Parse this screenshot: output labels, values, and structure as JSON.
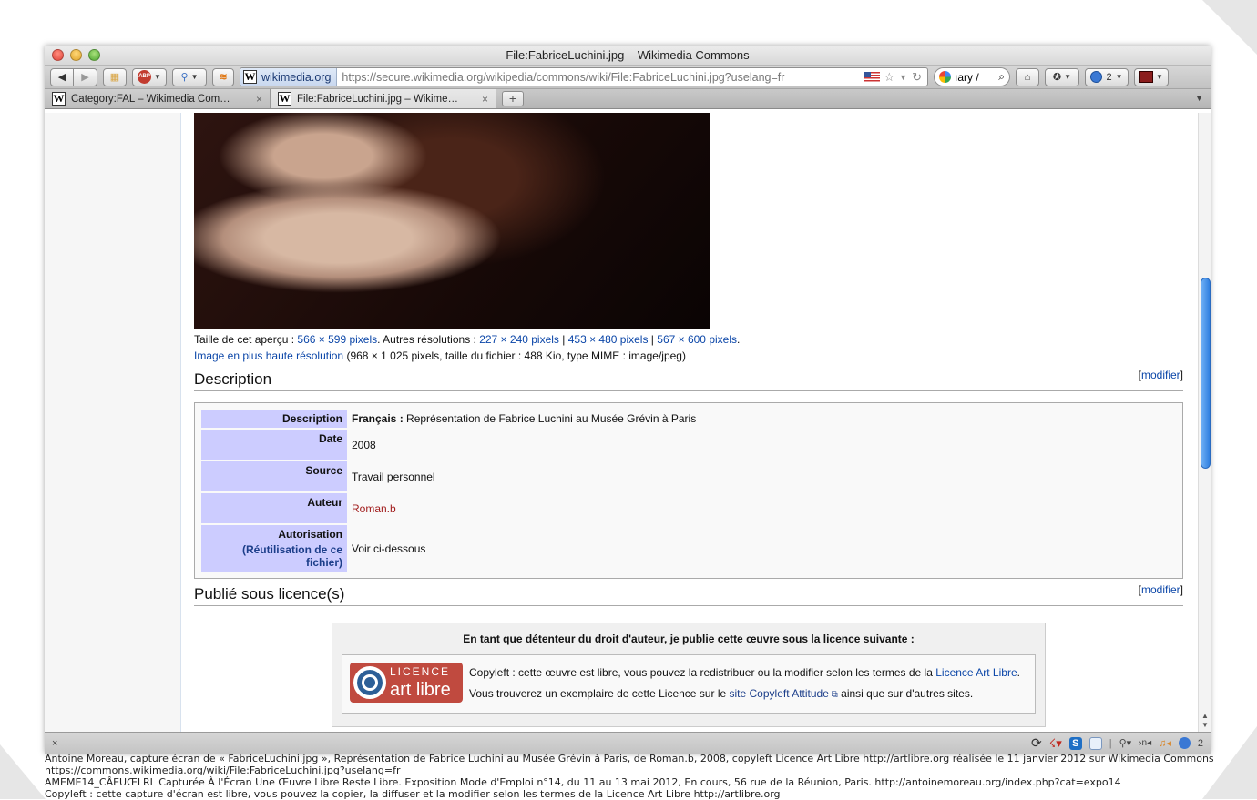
{
  "window": {
    "title": "File:FabriceLuchini.jpg – Wikimedia Commons"
  },
  "navbar": {
    "site_identity": "wikimedia.org",
    "url": "https://secure.wikimedia.org/wikipedia/commons/wiki/File:FabriceLuchini.jpg?uselang=fr",
    "search_text": "ıary /",
    "reader_count": "2",
    "abp_label": "ABP"
  },
  "tabs": [
    {
      "label": "Category:FAL – Wikimedia Com…",
      "close": "×"
    },
    {
      "label": "File:FabriceLuchini.jpg – Wikime…",
      "close": "×"
    }
  ],
  "newtab_label": "+",
  "preview": {
    "size_prefix": "Taille de cet aperçu : ",
    "size_link": "566 × 599 pixels",
    "other_prefix": ". Autres résolutions : ",
    "res1": "227 × 240 pixels",
    "sep": " | ",
    "res2": "453 × 480 pixels",
    "res3": "567 × 600 pixels",
    "end": ".",
    "highres_link": "Image en plus haute résolution",
    "highres_info": " (968 × 1 025 pixels, taille du fichier : 488 Kio, type MIME : image/jpeg)"
  },
  "description_heading": "Description",
  "edit_link": "modifier",
  "info": {
    "description_key": "Description",
    "lang": "Français :",
    "description_value": " Représentation de Fabrice Luchini au Musée Grévin à Paris",
    "date_key": "Date",
    "date_value": "2008",
    "source_key": "Source",
    "source_value": "Travail personnel",
    "author_key": "Auteur",
    "author_value": "Roman.b",
    "permission_key": "Autorisation",
    "permission_link": "(Réutilisation de ce fichier)",
    "permission_value": "Voir ci-dessous"
  },
  "license_heading": "Publié sous licence(s)",
  "license": {
    "header": "En tant que détenteur du droit d'auteur, je publie cette œuvre sous la licence suivante :",
    "logo_line1": "LICENCE",
    "logo_line2": "art libre",
    "text1": "Copyleft : cette œuvre est libre, vous pouvez la redistribuer ou la modifier selon les termes de la ",
    "link1": "Licence Art Libre",
    "text1_end": ".",
    "text2": "Vous trouverez un exemplaire de cette Licence sur le ",
    "link2": "site Copyleft Attitude",
    "text2_end": " ainsi que sur d'autres sites."
  },
  "statusbar": {
    "close": "×",
    "counter": "2"
  },
  "caption": [
    "Antoine Moreau, capture écran de « FabriceLuchini.jpg », Représentation de Fabrice Luchini au Musée Grévin à Paris, de Roman.b, 2008, copyleft Licence Art Libre http://artlibre.org réalisée le 11 janvier 2012 sur Wikimedia Commons",
    "https://commons.wikimedia.org/wiki/File:FabriceLuchini.jpg?uselang=fr",
    "AMEME14_CÂEUŒLRL Capturée À l'Écran Une Œuvre Libre Reste Libre. Exposition Mode d'Emploi n°14, du 11 au 13 mai 2012, En cours, 56 rue de la Réunion, Paris. http://antoinemoreau.org/index.php?cat=expo14",
    "Copyleft : cette capture d'écran est libre, vous pouvez la copier, la diffuser et la modifier selon les termes de la Licence Art Libre http://artlibre.org"
  ],
  "colors": {
    "link": "#0b46a8",
    "redlink": "#a11d1d",
    "infobox_key": "#ccccff",
    "license_logo": "#c04a3f",
    "scroll_thumb": "#2f7fe0"
  }
}
